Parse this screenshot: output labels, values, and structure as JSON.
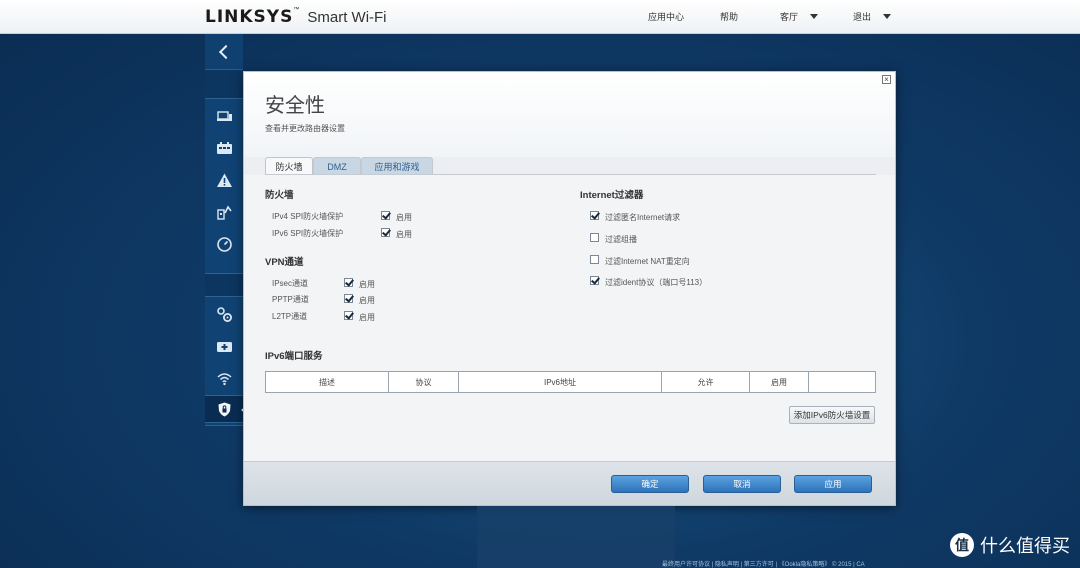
{
  "header": {
    "brand": "LINKSYS",
    "trademark": "™",
    "product": "Smart Wi-Fi",
    "nav": {
      "app_center": "应用中心",
      "help": "帮助",
      "guest": "客厅",
      "logout": "退出"
    }
  },
  "sidebar": {
    "icons": [
      "back-chevron-icon",
      "devices-icon",
      "network-map-icon",
      "alert-icon",
      "media-prioritization-icon",
      "speed-test-icon",
      "settings-gears-icon",
      "router-icon",
      "wifi-icon",
      "security-shield-icon"
    ]
  },
  "dialog": {
    "title": "安全性",
    "subtitle": "查看并更改路由器设置",
    "close": "×",
    "tabs": [
      {
        "label": "防火墙",
        "active": true
      },
      {
        "label": "DMZ",
        "active": false
      },
      {
        "label": "应用和游戏",
        "active": false
      }
    ],
    "firewall": {
      "heading": "防火墙",
      "items": [
        {
          "label": "IPv4 SPI防火墙保护",
          "checkbox": "启用",
          "checked": true
        },
        {
          "label": "IPv6 SPI防火墙保护",
          "checkbox": "启用",
          "checked": true
        }
      ]
    },
    "vpn": {
      "heading": "VPN通道",
      "items": [
        {
          "label": "IPsec通道",
          "checkbox": "启用",
          "checked": true
        },
        {
          "label": "PPTP通道",
          "checkbox": "启用",
          "checked": true
        },
        {
          "label": "L2TP通道",
          "checkbox": "启用",
          "checked": true
        }
      ]
    },
    "internet_filter": {
      "heading": "Internet过滤器",
      "items": [
        {
          "label": "过滤匿名Internet请求",
          "checked": true
        },
        {
          "label": "过滤组播",
          "checked": false
        },
        {
          "label": "过滤Internet NAT重定向",
          "checked": false
        },
        {
          "label": "过滤ident协议（端口号113）",
          "checked": true
        }
      ]
    },
    "ipv6_services": {
      "heading": "IPv6端口服务",
      "columns": [
        "描述",
        "协议",
        "IPv6地址",
        "允许",
        "启用",
        ""
      ],
      "add_button": "添加IPv6防火墙设置"
    },
    "buttons": {
      "ok": "确定",
      "cancel": "取消",
      "apply": "应用"
    }
  },
  "footer_links": "最终用户许可协议 | 隐私声明 | 第三方许可 | 《Ookla隐私策略》 © 2015 | CA",
  "watermark": {
    "badge": "值",
    "text": "什么值得买"
  },
  "colors": {
    "background": "#0f3a66",
    "accent_button": "#2f73b8",
    "tab_inactive_text": "#2b5f90"
  }
}
